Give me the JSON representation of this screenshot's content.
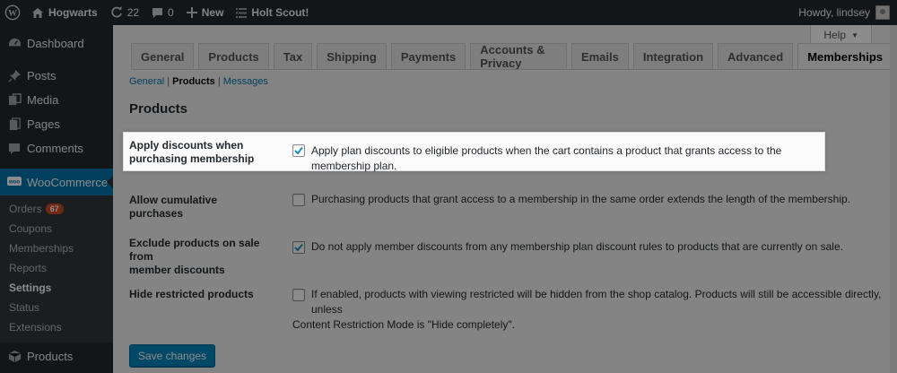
{
  "adminbar": {
    "site_name": "Hogwarts",
    "updates_count": "22",
    "comments_count": "0",
    "new_label": "New",
    "extra_label": "Holt Scout!",
    "howdy": "Howdy, lindsey"
  },
  "sidebar": {
    "items": [
      {
        "label": "Dashboard",
        "icon": "dashboard-icon"
      },
      {
        "label": "Posts",
        "icon": "pin-icon"
      },
      {
        "label": "Media",
        "icon": "media-icon"
      },
      {
        "label": "Pages",
        "icon": "pages-icon"
      },
      {
        "label": "Comments",
        "icon": "comment-icon"
      }
    ],
    "active": {
      "label": "WooCommerce",
      "icon": "woocommerce-icon"
    },
    "submenu": [
      {
        "label": "Orders",
        "badge": "67"
      },
      {
        "label": "Coupons"
      },
      {
        "label": "Memberships"
      },
      {
        "label": "Reports"
      },
      {
        "label": "Settings"
      },
      {
        "label": "Status"
      },
      {
        "label": "Extensions"
      }
    ],
    "after": {
      "label": "Products",
      "icon": "products-icon"
    }
  },
  "help": {
    "label": "Help"
  },
  "tabs": [
    "General",
    "Products",
    "Tax",
    "Shipping",
    "Payments",
    "Accounts & Privacy",
    "Emails",
    "Integration",
    "Advanced",
    "Memberships"
  ],
  "active_tab": "Memberships",
  "subnav": {
    "general": "General",
    "products": "Products",
    "messages": "Messages",
    "sep": "|"
  },
  "section_title": "Products",
  "settings": [
    {
      "label_line1": "Apply discounts when",
      "label_line2": "purchasing membership",
      "text_line1": "Apply plan discounts to eligible products when the cart contains a product that grants access to the membership plan.",
      "text_line2": "",
      "checked": true
    },
    {
      "label_line1": "Allow cumulative purchases",
      "label_line2": "",
      "text_line1": "Purchasing products that grant access to a membership in the same order extends the length of the membership.",
      "text_line2": "",
      "checked": false
    },
    {
      "label_line1": "Exclude products on sale from",
      "label_line2": "member discounts",
      "text_line1": "Do not apply member discounts from any membership plan discount rules to products that are currently on sale.",
      "text_line2": "",
      "checked": true
    },
    {
      "label_line1": "Hide restricted products",
      "label_line2": "",
      "text_line1": "If enabled, products with viewing restricted will be hidden from the shop catalog. Products will still be accessible directly, unless",
      "text_line2": "Content Restriction Mode is \"Hide completely\".",
      "checked": false
    }
  ],
  "save_label": "Save changes",
  "colors": {
    "accent": "#0073aa",
    "adminbar": "#23282d",
    "badge": "#ca4a1f",
    "button": "#0085ba"
  }
}
